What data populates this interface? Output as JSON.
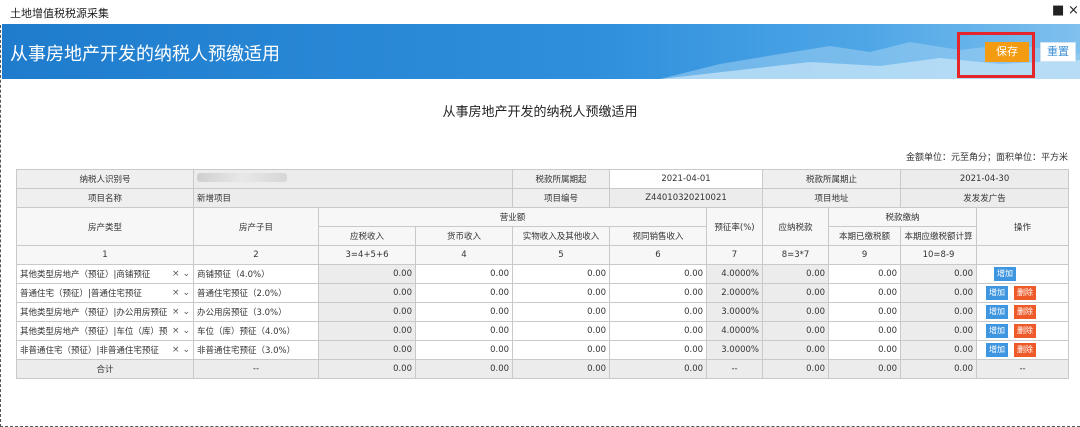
{
  "window": {
    "title": "土地增值税税源采集",
    "restore_icon": "■",
    "close_icon": "×"
  },
  "banner": {
    "title": "从事房地产开发的纳税人预缴适用",
    "save_label": "保存",
    "reset_label": "重置"
  },
  "form": {
    "title": "从事房地产开发的纳税人预缴适用",
    "units": "金额单位：元至角分；面积单位：平方米",
    "taxpayer_id_label": "纳税人识别号",
    "tax_period_start_label": "税款所属期起",
    "tax_period_start": "2021-04-01",
    "tax_period_end_label": "税款所属期止",
    "tax_period_end": "2021-04-30",
    "project_name_label": "项目名称",
    "project_name": "新增项目",
    "project_no_label": "项目编号",
    "project_no": "Z44010320210021",
    "project_address_label": "项目地址",
    "project_address": "发发发广告"
  },
  "table": {
    "headers": {
      "type": "房产类型",
      "subtype": "房产子目",
      "revenue": "营业额",
      "taxable_income": "应税收入",
      "monetary_income": "货币收入",
      "physical_income": "实物收入及其他收入",
      "deemed_income": "视同销售收入",
      "rate": "预征率(%)",
      "tax_payable": "应纳税款",
      "tax_payment": "税款缴纳",
      "paid": "本期已缴税额",
      "to_pay": "本期应缴税额计算",
      "ops": "操作"
    },
    "index_row": [
      "1",
      "2",
      "3=4+5+6",
      "4",
      "5",
      "6",
      "7",
      "8=3*7",
      "9",
      "10=8-9"
    ],
    "rows": [
      {
        "type": "其他类型房地产（预征）|商铺预征",
        "subtype": "商铺预征（4.0%）",
        "taxable": "0.00",
        "monetary": "0.00",
        "physical": "0.00",
        "deemed": "0.00",
        "rate": "4.0000%",
        "tax": "0.00",
        "paid": "0.00",
        "to_pay": "0.00",
        "add": "增加"
      },
      {
        "type": "普通住宅（预征）|普通住宅预征",
        "subtype": "普通住宅预征（2.0%）",
        "taxable": "0.00",
        "monetary": "0.00",
        "physical": "0.00",
        "deemed": "0.00",
        "rate": "2.0000%",
        "tax": "0.00",
        "paid": "0.00",
        "to_pay": "0.00",
        "add": "增加",
        "del": "删除"
      },
      {
        "type": "其他类型房地产（预征）|办公用房预征",
        "subtype": "办公用房预征（3.0%）",
        "taxable": "0.00",
        "monetary": "0.00",
        "physical": "0.00",
        "deemed": "0.00",
        "rate": "3.0000%",
        "tax": "0.00",
        "paid": "0.00",
        "to_pay": "0.00",
        "add": "增加",
        "del": "删除"
      },
      {
        "type": "其他类型房地产（预征）|车位（库）预",
        "subtype": "车位（库）预征（4.0%）",
        "taxable": "0.00",
        "monetary": "0.00",
        "physical": "0.00",
        "deemed": "0.00",
        "rate": "4.0000%",
        "tax": "0.00",
        "paid": "0.00",
        "to_pay": "0.00",
        "add": "增加",
        "del": "删除"
      },
      {
        "type": "非普通住宅（预征）|非普通住宅预征",
        "subtype": "非普通住宅预征（3.0%）",
        "taxable": "0.00",
        "monetary": "0.00",
        "physical": "0.00",
        "deemed": "0.00",
        "rate": "3.0000%",
        "tax": "0.00",
        "paid": "0.00",
        "to_pay": "0.00",
        "add": "增加",
        "del": "删除"
      }
    ],
    "total": {
      "label": "合计",
      "subtype": "--",
      "taxable": "0.00",
      "monetary": "0.00",
      "physical": "0.00",
      "deemed": "0.00",
      "rate": "--",
      "tax": "0.00",
      "paid": "0.00",
      "to_pay": "0.00",
      "ops": "--"
    },
    "select_icons": {
      "clear": "×",
      "dropdown": "⌄"
    }
  }
}
